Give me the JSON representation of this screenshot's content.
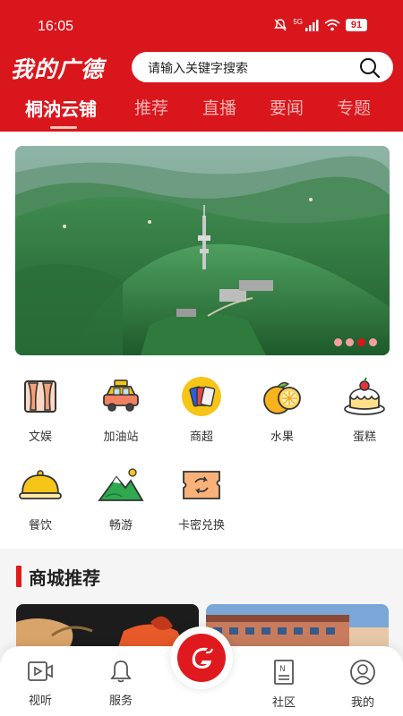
{
  "status_bar": {
    "time": "16:05",
    "battery": "91",
    "signal_label": "5G"
  },
  "header": {
    "logo": "我的广德",
    "search_placeholder": "请输入关键字搜索",
    "tabs": [
      {
        "label": "桐汭云铺",
        "active": true
      },
      {
        "label": "推荐",
        "active": false
      },
      {
        "label": "直播",
        "active": false
      },
      {
        "label": "要闻",
        "active": false
      },
      {
        "label": "专题",
        "active": false
      }
    ]
  },
  "banner": {
    "image": "aerial-forest-tower-photo",
    "dot_count": 4,
    "active_dot": 3
  },
  "services": [
    {
      "label": "文娱",
      "icon": "theater-icon"
    },
    {
      "label": "加油站",
      "icon": "car-icon"
    },
    {
      "label": "商超",
      "icon": "shopping-cards-icon"
    },
    {
      "label": "水果",
      "icon": "orange-icon"
    },
    {
      "label": "蛋糕",
      "icon": "cake-icon"
    },
    {
      "label": "餐饮",
      "icon": "dish-cover-icon"
    },
    {
      "label": "畅游",
      "icon": "mountain-icon"
    },
    {
      "label": "卡密兑换",
      "icon": "ticket-exchange-icon"
    }
  ],
  "mall_section": {
    "title": "商城推荐"
  },
  "bottom_nav": [
    {
      "label": "视听",
      "icon": "video-icon"
    },
    {
      "label": "服务",
      "icon": "bell-icon"
    },
    {
      "label": "",
      "icon": "center-logo-icon"
    },
    {
      "label": "社区",
      "icon": "news-icon"
    },
    {
      "label": "我的",
      "icon": "user-icon"
    }
  ],
  "colors": {
    "brand_red": "#d9161c",
    "accent_yellow": "#f5c518"
  }
}
